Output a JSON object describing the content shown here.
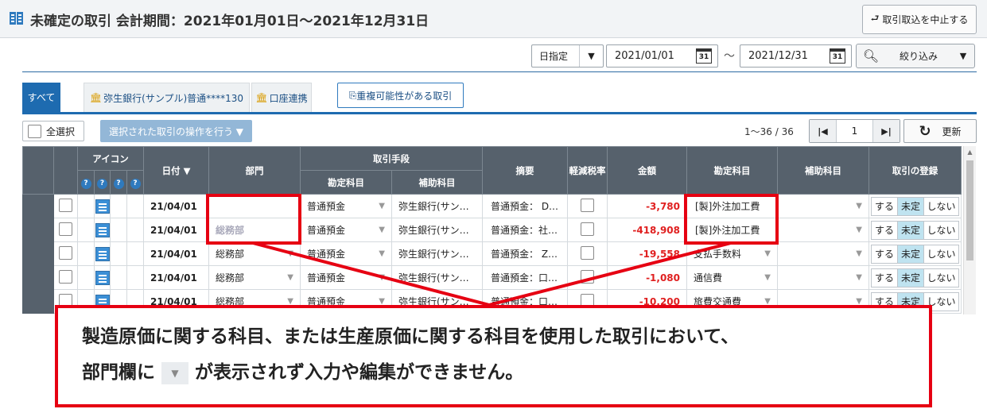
{
  "header": {
    "title": "未確定の取引 会計期間：2021年01月01日～2021年12月31日",
    "cancel_label": "取引取込を中止する"
  },
  "filter": {
    "date_mode": "日指定",
    "date_from": "2021/01/01",
    "date_to": "2021/12/31",
    "calendar_label": "31",
    "tilde": "～",
    "narrow_label": "絞り込み"
  },
  "tabs": {
    "all": "すべて",
    "bank": "弥生銀行(サンプル)普通****130",
    "link": "口座連携",
    "duplicate": "重複可能性がある取引"
  },
  "toolbar": {
    "select_all": "全選択",
    "bulk_action": "選択された取引の操作を行う ▼",
    "page_info": "1～36 / 36",
    "page_number": "1",
    "refresh": "更新"
  },
  "table_headers": {
    "icon": "アイコン",
    "date": "日付 ▼",
    "department": "部門",
    "method": "取引手段",
    "method_account": "勘定科目",
    "method_sub": "補助科目",
    "memo": "摘要",
    "reduced_tax": "軽減税率",
    "amount": "金額",
    "account": "勘定科目",
    "sub_account": "補助科目",
    "register": "取引の登録",
    "q": "?"
  },
  "register_options": {
    "yes": "する",
    "pending": "未定",
    "no": "しない"
  },
  "rows": [
    {
      "date": "21/04/01",
      "dept": "",
      "m_acct": "普通預金",
      "m_sub": "弥生銀行(サン…",
      "memo": "普通預金： D…",
      "amount": "-3,780",
      "acct": "[製]外注加工費",
      "sub": ""
    },
    {
      "date": "21/04/01",
      "dept": "総務部",
      "m_acct": "普通預金",
      "m_sub": "弥生銀行(サン…",
      "memo": "普通預金：社…",
      "amount": "-418,908",
      "acct": "[製]外注加工費",
      "sub": ""
    },
    {
      "date": "21/04/01",
      "dept": "総務部",
      "m_acct": "普通預金",
      "m_sub": "弥生銀行(サン…",
      "memo": "普通預金： Z…",
      "amount": "-19,558",
      "acct": "支払手数料",
      "sub": ""
    },
    {
      "date": "21/04/01",
      "dept": "総務部",
      "m_acct": "普通預金",
      "m_sub": "弥生銀行(サン…",
      "memo": "普通預金：口…",
      "amount": "-1,080",
      "acct": "通信費",
      "sub": ""
    },
    {
      "date": "21/04/01",
      "dept": "総務部",
      "m_acct": "普通預金",
      "m_sub": "弥生銀行(サン…",
      "memo": "普通預金：口…",
      "amount": "-10,200",
      "acct": "旅費交通費",
      "sub": ""
    }
  ],
  "callout": {
    "line1": "製造原価に関する科目、または生産原価に関する科目を使用した取引において、",
    "line2_a": "部門欄に",
    "line2_b": "が表示されず入力や編集ができません。"
  }
}
